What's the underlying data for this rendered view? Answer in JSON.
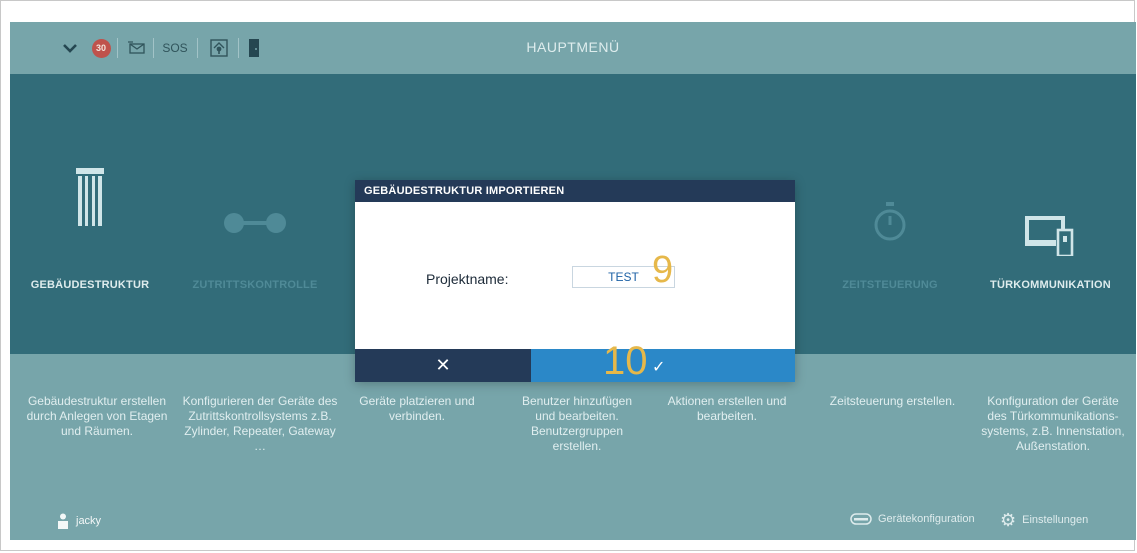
{
  "topbar": {
    "title": "HAUPTMENÜ",
    "badge_count": "30",
    "sos_label": "SOS"
  },
  "tiles": [
    {
      "label": "GEBÄUDESTRUKTUR",
      "icon": "building-icon"
    },
    {
      "label": "ZUTRITTSKONTROLLE",
      "icon": "connection-icon"
    },
    {
      "label": "ZEITSTEUERUNG",
      "icon": "stopwatch-icon"
    },
    {
      "label": "TÜRKOMMUNIKATION",
      "icon": "intercom-icon"
    }
  ],
  "descriptions": [
    "Gebäudestruktur erstellen durch Anlegen von Etagen und Räumen.",
    "Konfigurieren der Geräte des Zutrittskontrollsystems z.B. Zylinder, Repeater, Gateway …",
    "Geräte platzieren und verbinden.",
    "Benutzer hinzufügen und bearbeiten. Benutzergruppen erstellen.",
    "Aktionen erstellen und bearbeiten.",
    "Zeitsteuerung erstellen.",
    "Konfiguration der Geräte des Türkommunikations-systems, z.B. Innenstation, Außenstation."
  ],
  "footer": {
    "user": "jacky",
    "device_config": "Gerätekonfiguration",
    "settings": "Einstellungen"
  },
  "dialog": {
    "title": "GEBÄUDESTRUKTUR IMPORTIEREN",
    "field_label": "Projektname:",
    "field_value": "TEST",
    "cancel_symbol": "✕",
    "ok_symbol": "✓"
  },
  "annotations": {
    "step_field": "9",
    "step_ok": "10"
  },
  "colors": {
    "band": "#2d6876",
    "background": "#78a5ab",
    "dialog_header": "#243a58",
    "ok_button": "#2b88c8",
    "annotation": "#e6b84a"
  }
}
